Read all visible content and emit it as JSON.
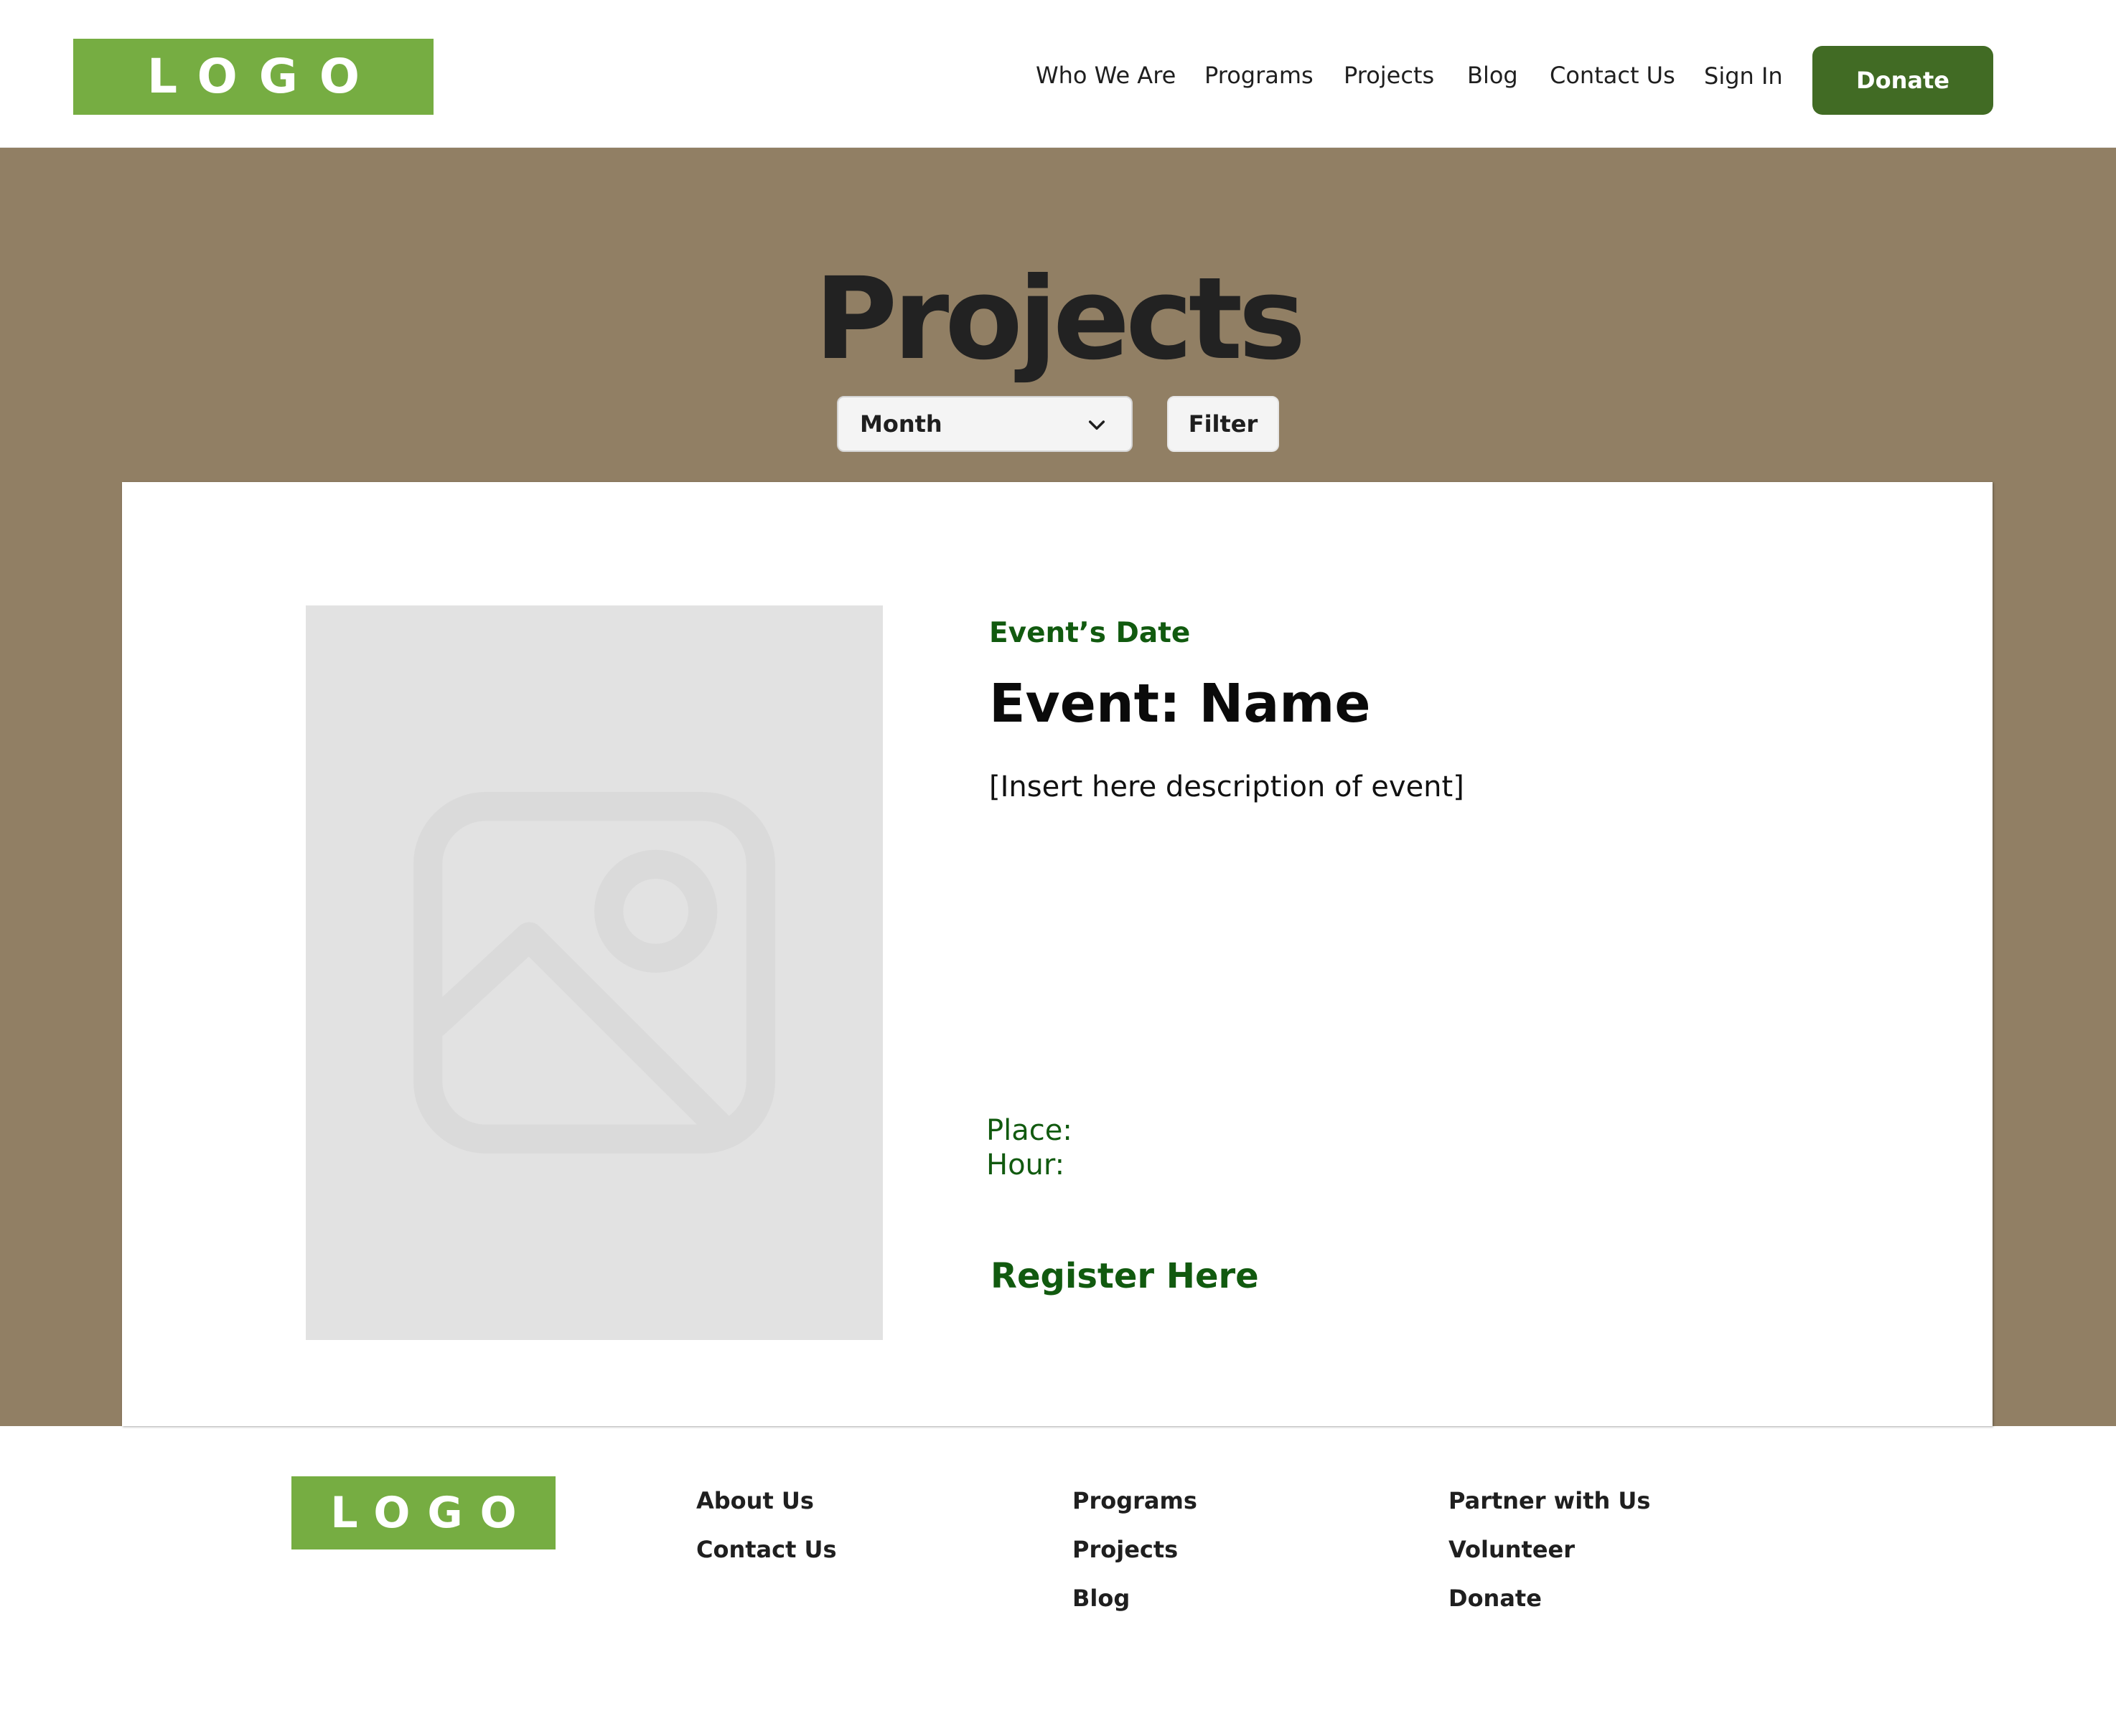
{
  "header": {
    "logo_text": "LOGO",
    "nav": [
      "Who We Are",
      "Programs",
      "Projects",
      "Blog",
      "Contact Us"
    ],
    "sign_in": "Sign In",
    "donate": "Donate"
  },
  "hero": {
    "title": "Projects",
    "month_select": {
      "value": "Month",
      "icon": "chevron-down-icon"
    },
    "filter_label": "Filter"
  },
  "event": {
    "image_icon": "image-placeholder-icon",
    "date_label": "Event’s Date",
    "name": "Event: Name",
    "description": "[Insert here description of event]",
    "place_label": "Place:",
    "hour_label": "Hour:",
    "register_label": "Register Here"
  },
  "footer": {
    "logo_text": "LOGO",
    "columns": [
      [
        "About Us",
        "Contact Us"
      ],
      [
        "Programs",
        "Projects",
        "Blog"
      ],
      [
        "Partner with Us",
        "Volunteer",
        "Donate"
      ]
    ]
  },
  "colors": {
    "brand_green": "#76ad42",
    "donate_green": "#416b24",
    "accent_text_green": "#115a0f",
    "hero_background": "#917f64",
    "placeholder_gray": "#e2e2e2"
  }
}
